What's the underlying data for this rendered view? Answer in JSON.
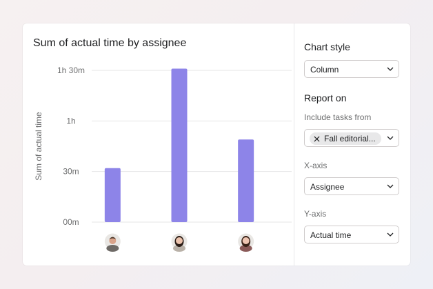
{
  "report": {
    "title": "Sum of actual time by assignee"
  },
  "settings": {
    "chart_style_title": "Chart style",
    "chart_style_value": "Column",
    "report_on_title": "Report on",
    "include_tasks_label": "Include tasks from",
    "include_tasks_chip": "Fall editorial...",
    "xaxis_label": "X-axis",
    "xaxis_value": "Assignee",
    "yaxis_label": "Y-axis",
    "yaxis_value": "Actual time"
  },
  "colors": {
    "bar": "#8d84e8",
    "grid": "#e4e4e6",
    "axis_text": "#6d6e6f"
  },
  "chart_data": {
    "type": "bar",
    "ylabel": "Sum of actual time",
    "yunit": "minutes",
    "ylim": [
      0,
      90
    ],
    "yticks": [
      {
        "value": 0,
        "label": "00m"
      },
      {
        "value": 30,
        "label": "30m"
      },
      {
        "value": 60,
        "label": "1h"
      },
      {
        "value": 90,
        "label": "1h 30m"
      }
    ],
    "categories": [
      "assignee-1",
      "assignee-2",
      "assignee-3"
    ],
    "category_display": "avatar",
    "values": [
      32,
      91,
      49
    ]
  }
}
